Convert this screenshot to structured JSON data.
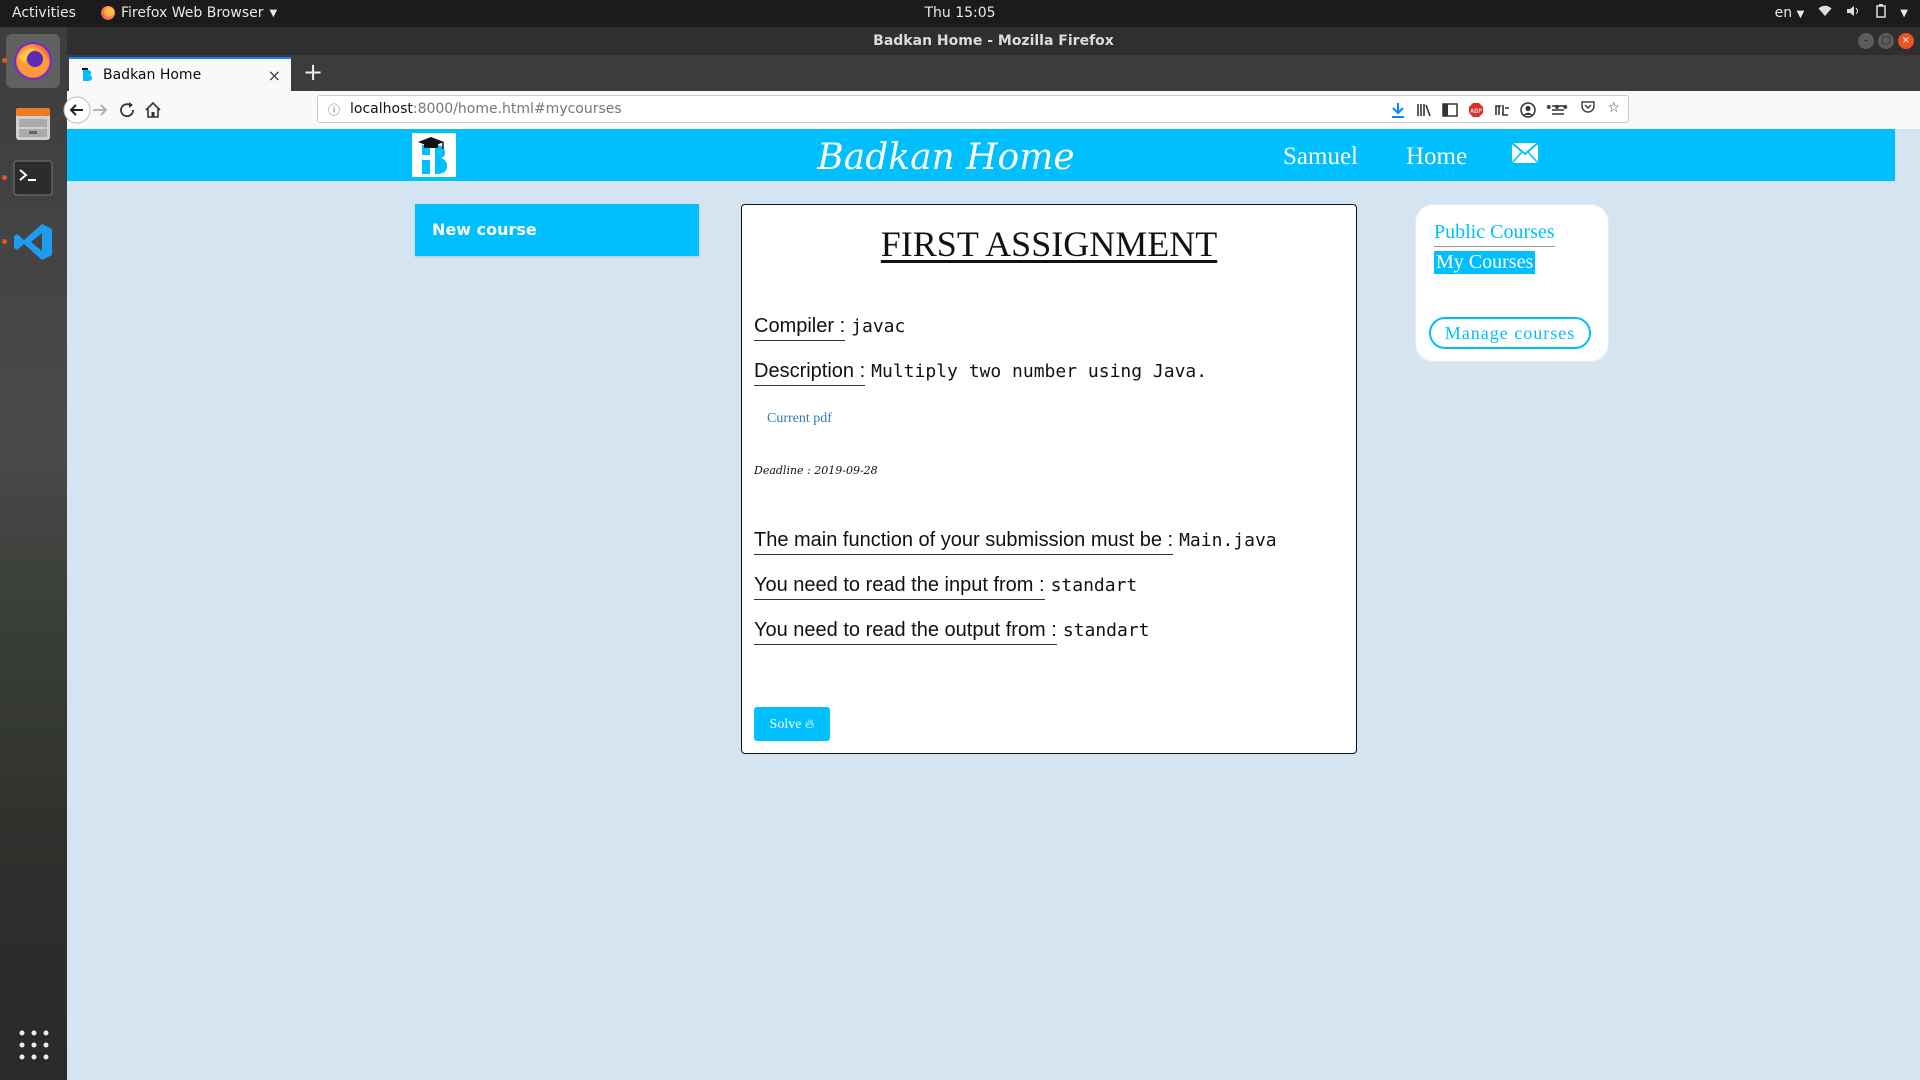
{
  "topbar": {
    "activities": "Activities",
    "app_menu": "Firefox Web Browser",
    "clock": "Thu 15:05",
    "lang": "en"
  },
  "window": {
    "title": "Badkan Home - Mozilla Firefox"
  },
  "tab": {
    "label": "Badkan Home"
  },
  "urlbar": {
    "host": "localhost",
    "path": ":8000/home.html#mycourses"
  },
  "site": {
    "title": "Badkan Home",
    "nav_user": "Samuel",
    "nav_home": "Home"
  },
  "sidebar_left": {
    "new_course": "New course"
  },
  "assignment": {
    "title": "FIRST ASSIGNMENT",
    "compiler_label": "Compiler :",
    "compiler_value": "javac",
    "description_label": "Description :",
    "description_value": "Multiply two number using Java.",
    "pdf_link": "Current pdf",
    "deadline": "Deadline : 2019-09-28",
    "main_label": "The main function of your submission must be :",
    "main_value": "Main.java",
    "input_label": "You need to read the input from :",
    "input_value": "standart",
    "output_label": "You need to read the output from :",
    "output_value": "standart",
    "solve": "Solve"
  },
  "sidebar_right": {
    "public_courses": "Public Courses",
    "my_courses": "My Courses",
    "manage_courses": "Manage courses"
  },
  "colors": {
    "accent": "#00bfff",
    "page_bg": "#d4e4f0",
    "ubuntu_orange": "#e95420"
  }
}
